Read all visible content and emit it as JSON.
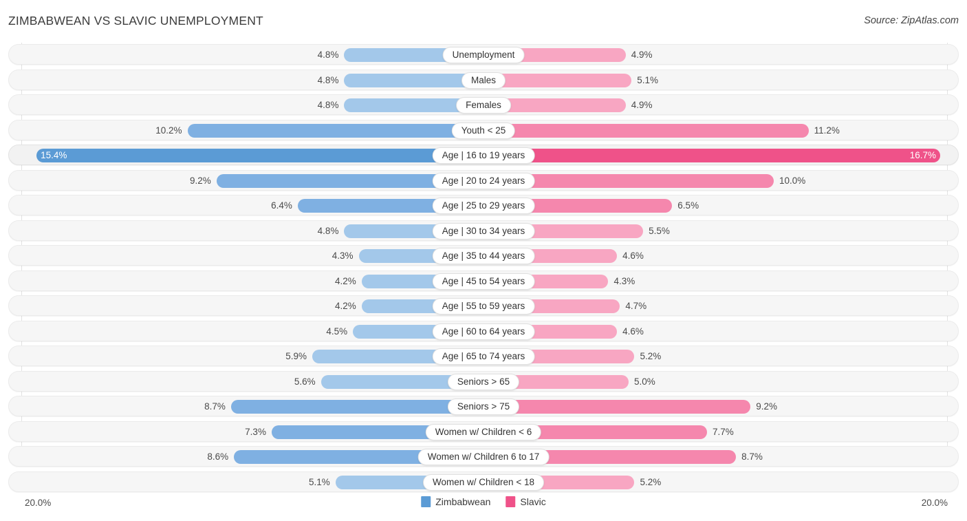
{
  "header": {
    "title": "ZIMBABWEAN VS SLAVIC UNEMPLOYMENT",
    "source": "Source: ZipAtlas.com"
  },
  "axis": {
    "left_label": "20.0%",
    "right_label": "20.0%",
    "max": 20.0
  },
  "legend": {
    "items": [
      {
        "label": "Zimbabwean",
        "color": "#5b9bd5",
        "swatch": "blue"
      },
      {
        "label": "Slavic",
        "color": "#ef5289",
        "swatch": "pink"
      }
    ]
  },
  "chart_data": {
    "type": "bar",
    "title": "ZIMBABWEAN VS SLAVIC UNEMPLOYMENT",
    "orientation": "horizontal-diverging",
    "xlabel": "",
    "ylabel": "",
    "xlim": [
      20.0,
      20.0
    ],
    "grid": true,
    "legend_position": "bottom-center",
    "categories": [
      "Unemployment",
      "Males",
      "Females",
      "Youth < 25",
      "Age | 16 to 19 years",
      "Age | 20 to 24 years",
      "Age | 25 to 29 years",
      "Age | 30 to 34 years",
      "Age | 35 to 44 years",
      "Age | 45 to 54 years",
      "Age | 55 to 59 years",
      "Age | 60 to 64 years",
      "Age | 65 to 74 years",
      "Seniors > 65",
      "Seniors > 75",
      "Women w/ Children < 6",
      "Women w/ Children 6 to 17",
      "Women w/ Children < 18"
    ],
    "series": [
      {
        "name": "Zimbabwean",
        "color": "#5b9bd5",
        "values": [
          4.8,
          4.8,
          4.8,
          10.2,
          15.4,
          9.2,
          6.4,
          4.8,
          4.3,
          4.2,
          4.2,
          4.5,
          5.9,
          5.6,
          8.7,
          7.3,
          8.6,
          5.1
        ]
      },
      {
        "name": "Slavic",
        "color": "#ef5289",
        "values": [
          4.9,
          5.1,
          4.9,
          11.2,
          16.7,
          10.0,
          6.5,
          5.5,
          4.6,
          4.3,
          4.7,
          4.6,
          5.2,
          5.0,
          9.2,
          7.7,
          8.7,
          5.2
        ]
      }
    ]
  },
  "rows": [
    {
      "label": "Unemployment",
      "left": "4.8%",
      "right": "4.9%",
      "lv": 4.8,
      "rv": 4.9,
      "level": "low",
      "inside": false
    },
    {
      "label": "Males",
      "left": "4.8%",
      "right": "5.1%",
      "lv": 4.8,
      "rv": 5.1,
      "level": "low",
      "inside": false
    },
    {
      "label": "Females",
      "left": "4.8%",
      "right": "4.9%",
      "lv": 4.8,
      "rv": 4.9,
      "level": "low",
      "inside": false
    },
    {
      "label": "Youth < 25",
      "left": "10.2%",
      "right": "11.2%",
      "lv": 10.2,
      "rv": 11.2,
      "level": "mid",
      "inside": false
    },
    {
      "label": "Age | 16 to 19 years",
      "left": "15.4%",
      "right": "16.7%",
      "lv": 15.4,
      "rv": 16.7,
      "level": "high",
      "inside": true
    },
    {
      "label": "Age | 20 to 24 years",
      "left": "9.2%",
      "right": "10.0%",
      "lv": 9.2,
      "rv": 10.0,
      "level": "mid",
      "inside": false
    },
    {
      "label": "Age | 25 to 29 years",
      "left": "6.4%",
      "right": "6.5%",
      "lv": 6.4,
      "rv": 6.5,
      "level": "mid",
      "inside": false
    },
    {
      "label": "Age | 30 to 34 years",
      "left": "4.8%",
      "right": "5.5%",
      "lv": 4.8,
      "rv": 5.5,
      "level": "low",
      "inside": false
    },
    {
      "label": "Age | 35 to 44 years",
      "left": "4.3%",
      "right": "4.6%",
      "lv": 4.3,
      "rv": 4.6,
      "level": "low",
      "inside": false
    },
    {
      "label": "Age | 45 to 54 years",
      "left": "4.2%",
      "right": "4.3%",
      "lv": 4.2,
      "rv": 4.3,
      "level": "low",
      "inside": false
    },
    {
      "label": "Age | 55 to 59 years",
      "left": "4.2%",
      "right": "4.7%",
      "lv": 4.2,
      "rv": 4.7,
      "level": "low",
      "inside": false
    },
    {
      "label": "Age | 60 to 64 years",
      "left": "4.5%",
      "right": "4.6%",
      "lv": 4.5,
      "rv": 4.6,
      "level": "low",
      "inside": false
    },
    {
      "label": "Age | 65 to 74 years",
      "left": "5.9%",
      "right": "5.2%",
      "lv": 5.9,
      "rv": 5.2,
      "level": "low",
      "inside": false
    },
    {
      "label": "Seniors > 65",
      "left": "5.6%",
      "right": "5.0%",
      "lv": 5.6,
      "rv": 5.0,
      "level": "low",
      "inside": false
    },
    {
      "label": "Seniors > 75",
      "left": "8.7%",
      "right": "9.2%",
      "lv": 8.7,
      "rv": 9.2,
      "level": "mid",
      "inside": false
    },
    {
      "label": "Women w/ Children < 6",
      "left": "7.3%",
      "right": "7.7%",
      "lv": 7.3,
      "rv": 7.7,
      "level": "mid",
      "inside": false
    },
    {
      "label": "Women w/ Children 6 to 17",
      "left": "8.6%",
      "right": "8.7%",
      "lv": 8.6,
      "rv": 8.7,
      "level": "mid",
      "inside": false
    },
    {
      "label": "Women w/ Children < 18",
      "left": "5.1%",
      "right": "5.2%",
      "lv": 5.1,
      "rv": 5.2,
      "level": "low",
      "inside": false
    }
  ]
}
